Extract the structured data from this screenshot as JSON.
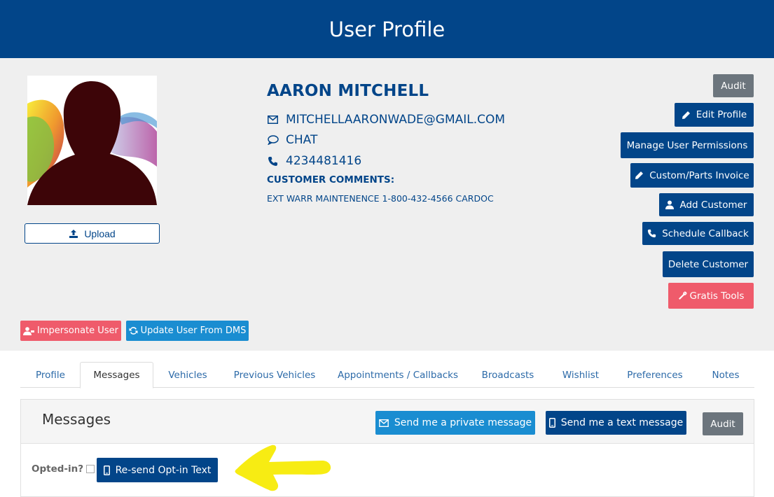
{
  "header": {
    "title": "User Profile"
  },
  "profile": {
    "name": "AARON MITCHELL",
    "email": "MITCHELLAARONWADE@GMAIL.COM",
    "chat": "CHAT",
    "phone": "4234481416",
    "comments_label": "CUSTOMER COMMENTS:",
    "comments": "EXT WARR MAINTENENCE 1-800-432-4566 CARDOC",
    "upload_label": "Upload"
  },
  "actions": {
    "audit": "Audit",
    "edit_profile": "Edit Profile",
    "manage_permissions": "Manage User Permissions",
    "custom_parts_invoice": "Custom/Parts Invoice",
    "add_customer": "Add Customer",
    "schedule_callback": "Schedule Callback",
    "delete_customer": "Delete Customer",
    "gratis_tools": "Gratis Tools",
    "impersonate_user": "Impersonate User",
    "update_from_dms": "Update User From DMS"
  },
  "tabs": [
    {
      "label": "Profile"
    },
    {
      "label": "Messages"
    },
    {
      "label": "Vehicles"
    },
    {
      "label": "Previous Vehicles"
    },
    {
      "label": "Appointments / Callbacks"
    },
    {
      "label": "Broadcasts"
    },
    {
      "label": "Wishlist"
    },
    {
      "label": "Preferences"
    },
    {
      "label": "Notes"
    }
  ],
  "active_tab": "Messages",
  "messages": {
    "title": "Messages",
    "private_message": "Send me a private message",
    "text_message": "Send me a text message",
    "audit": "Audit",
    "opted_in_label": "Opted-in?",
    "resend_opt_in": "Re-send Opt-in Text"
  },
  "colors": {
    "header": "#024589",
    "navy_button": "#024589",
    "grey_button": "#6c757d",
    "red_button": "#ef5b6b",
    "blue_button": "#1a8dd1",
    "highlight_arrow": "#f7ec13"
  }
}
